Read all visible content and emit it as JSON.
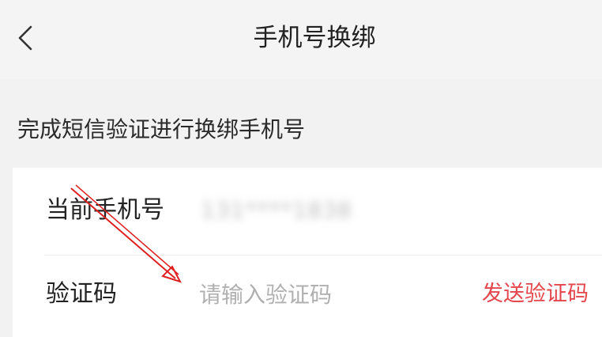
{
  "header": {
    "back_icon": "chevron-left-icon",
    "title": "手机号换绑"
  },
  "hint": "完成短信验证进行换绑手机号",
  "phone_row": {
    "label": "当前手机号",
    "value": "131****1838"
  },
  "code_row": {
    "label": "验证码",
    "placeholder": "请输入验证码",
    "send_label": "发送验证码"
  },
  "colors": {
    "accent": "#e5464b",
    "background": "#f2f2f2",
    "card": "#ffffff"
  }
}
